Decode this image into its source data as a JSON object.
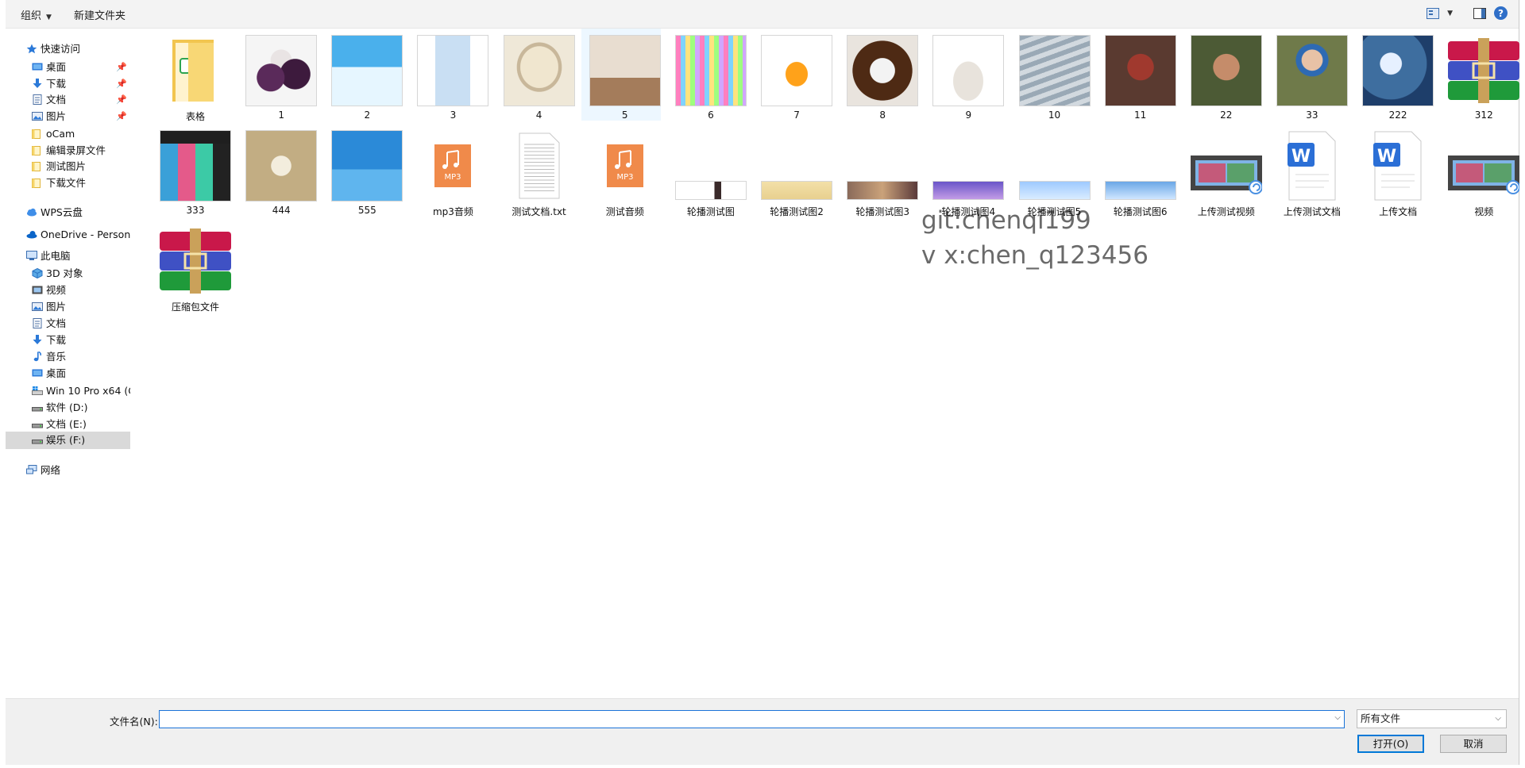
{
  "toolbar": {
    "organize_label": "组织",
    "new_folder_label": "新建文件夹"
  },
  "nav": {
    "items": [
      {
        "label": "快速访问",
        "icon": "star-icon",
        "pinned": false
      },
      {
        "label": "桌面",
        "icon": "desktop-icon",
        "pinned": true
      },
      {
        "label": "下载",
        "icon": "download-icon",
        "pinned": true
      },
      {
        "label": "文档",
        "icon": "document-icon",
        "pinned": true
      },
      {
        "label": "图片",
        "icon": "pictures-icon",
        "pinned": true
      },
      {
        "label": "oCam",
        "icon": "folder-icon",
        "pinned": false
      },
      {
        "label": "编辑录屏文件",
        "icon": "folder-icon",
        "pinned": false
      },
      {
        "label": "测试图片",
        "icon": "folder-icon",
        "pinned": false
      },
      {
        "label": "下载文件",
        "icon": "folder-icon",
        "pinned": false
      },
      {
        "label": "WPS云盘",
        "icon": "cloud-icon",
        "pinned": false
      },
      {
        "label": "OneDrive - Persona",
        "icon": "onedrive-icon",
        "pinned": false
      },
      {
        "label": "此电脑",
        "icon": "computer-icon",
        "pinned": false
      },
      {
        "label": "3D 对象",
        "icon": "3d-objects-icon",
        "pinned": false
      },
      {
        "label": "视频",
        "icon": "video-icon",
        "pinned": false
      },
      {
        "label": "图片",
        "icon": "pictures-icon",
        "pinned": false
      },
      {
        "label": "文档",
        "icon": "document-icon",
        "pinned": false
      },
      {
        "label": "下载",
        "icon": "download-icon",
        "pinned": false
      },
      {
        "label": "音乐",
        "icon": "music-icon",
        "pinned": false
      },
      {
        "label": "桌面",
        "icon": "desktop-icon",
        "pinned": false
      },
      {
        "label": "Win 10 Pro x64 (C",
        "icon": "windows-drive-icon",
        "pinned": false
      },
      {
        "label": "软件 (D:)",
        "icon": "drive-icon",
        "pinned": false
      },
      {
        "label": "文档 (E:)",
        "icon": "drive-icon",
        "pinned": false
      },
      {
        "label": "娱乐 (F:)",
        "icon": "drive-icon",
        "pinned": false,
        "selected": true
      },
      {
        "label": "网络",
        "icon": "network-icon",
        "pinned": false
      }
    ]
  },
  "files": [
    {
      "name": "表格",
      "icon": "folder-icon"
    },
    {
      "name": "1",
      "icon": "image-thumbnail-icon"
    },
    {
      "name": "2",
      "icon": "image-thumbnail-icon"
    },
    {
      "name": "3",
      "icon": "image-thumbnail-icon"
    },
    {
      "name": "4",
      "icon": "image-thumbnail-icon"
    },
    {
      "name": "5",
      "icon": "image-thumbnail-icon"
    },
    {
      "name": "6",
      "icon": "image-thumbnail-icon"
    },
    {
      "name": "7",
      "icon": "image-thumbnail-icon"
    },
    {
      "name": "8",
      "icon": "image-thumbnail-icon"
    },
    {
      "name": "9",
      "icon": "image-thumbnail-icon"
    },
    {
      "name": "10",
      "icon": "image-thumbnail-icon"
    },
    {
      "name": "11",
      "icon": "image-thumbnail-icon"
    },
    {
      "name": "22",
      "icon": "image-thumbnail-icon"
    },
    {
      "name": "33",
      "icon": "image-thumbnail-icon"
    },
    {
      "name": "222",
      "icon": "image-thumbnail-icon"
    },
    {
      "name": "312",
      "icon": "winrar-archive-icon"
    },
    {
      "name": "333",
      "icon": "image-thumbnail-icon"
    },
    {
      "name": "444",
      "icon": "image-thumbnail-icon"
    },
    {
      "name": "555",
      "icon": "image-thumbnail-icon"
    },
    {
      "name": "mp3音频",
      "icon": "mp3-file-icon"
    },
    {
      "name": "测试文档.txt",
      "icon": "text-file-icon"
    },
    {
      "name": "测试音频",
      "icon": "mp3-file-icon"
    },
    {
      "name": "轮播测试图",
      "icon": "image-thumbnail-icon"
    },
    {
      "name": "轮播测试图2",
      "icon": "image-thumbnail-icon"
    },
    {
      "name": "轮播测试图3",
      "icon": "image-thumbnail-icon"
    },
    {
      "name": "轮播测试图4",
      "icon": "image-thumbnail-icon"
    },
    {
      "name": "轮播测试图5",
      "icon": "image-thumbnail-icon"
    },
    {
      "name": "轮播测试图6",
      "icon": "image-thumbnail-icon"
    },
    {
      "name": "上传测试视频",
      "icon": "video-file-icon"
    },
    {
      "name": "上传测试文档",
      "icon": "word-document-icon"
    },
    {
      "name": "上传文档",
      "icon": "word-document-icon"
    },
    {
      "name": "视频",
      "icon": "video-file-icon"
    },
    {
      "name": "压缩包文件",
      "icon": "winrar-archive-icon"
    }
  ],
  "watermark": {
    "line1": "git:chenqi199",
    "line2": "v x:chen_q123456"
  },
  "footer": {
    "filename_label": "文件名(N):",
    "filename_value": "",
    "filetype_value": "所有文件",
    "open_label": "打开(O)",
    "cancel_label": "取消"
  },
  "colors": {
    "accent": "#0078d7",
    "selected_nav": "#d9d9d9",
    "folder": "#f8d775"
  }
}
